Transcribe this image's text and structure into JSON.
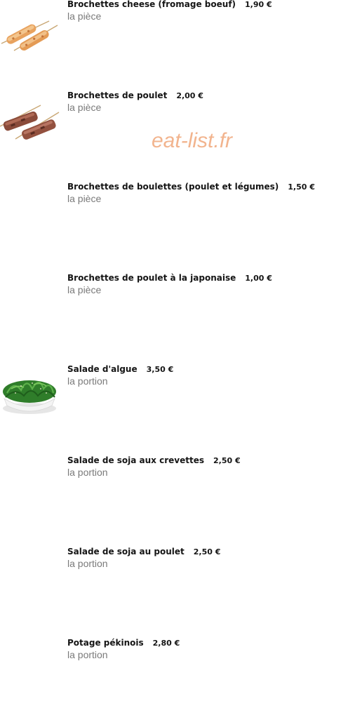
{
  "watermark": "eat-list.fr",
  "items": [
    {
      "name": "Brochettes cheese (fromage boeuf)",
      "price": "1,90 €",
      "unit": "la pièce",
      "image": "cheese-skewers"
    },
    {
      "name": "Brochettes de poulet",
      "price": "2,00 €",
      "unit": "la pièce",
      "image": "chicken-skewers"
    },
    {
      "name": "Brochettes de boulettes (poulet et légumes)",
      "price": "1,50 €",
      "unit": "la pièce",
      "image": ""
    },
    {
      "name": "Brochettes de poulet à la japonaise",
      "price": "1,00 €",
      "unit": "la pièce",
      "image": ""
    },
    {
      "name": "Salade d'algue",
      "price": "3,50 €",
      "unit": "la portion",
      "image": "seaweed-salad-bowl"
    },
    {
      "name": "Salade de soja aux crevettes",
      "price": "2,50 €",
      "unit": "la portion",
      "image": ""
    },
    {
      "name": "Salade de soja au poulet",
      "price": "2,50 €",
      "unit": "la portion",
      "image": ""
    },
    {
      "name": "Potage pékinois",
      "price": "2,80 €",
      "unit": "la portion",
      "image": ""
    }
  ]
}
